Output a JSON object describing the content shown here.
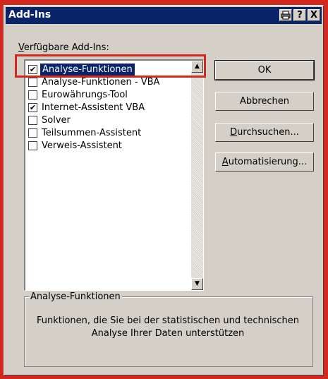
{
  "window": {
    "title": "Add-Ins",
    "buttons": {
      "toolbar_icon": "printer-icon",
      "help": "?",
      "close": "X"
    }
  },
  "available_label_prefix": "V",
  "available_label_rest": "erfügbare Add-Ins:",
  "addins": [
    {
      "label": "Analyse-Funktionen",
      "checked": true,
      "selected": true
    },
    {
      "label": "Analyse-Funktionen - VBA",
      "checked": false,
      "selected": false
    },
    {
      "label": "Eurowährungs-Tool",
      "checked": false,
      "selected": false
    },
    {
      "label": "Internet-Assistent VBA",
      "checked": true,
      "selected": false
    },
    {
      "label": "Solver",
      "checked": false,
      "selected": false
    },
    {
      "label": "Teilsummen-Assistent",
      "checked": false,
      "selected": false
    },
    {
      "label": "Verweis-Assistent",
      "checked": false,
      "selected": false
    }
  ],
  "buttons": {
    "ok": "OK",
    "cancel": "Abbrechen",
    "browse_u": "D",
    "browse_rest": "urchsuchen...",
    "automation_u": "A",
    "automation_rest": "utomatisierung..."
  },
  "description": {
    "title": "Analyse-Funktionen",
    "text": "Funktionen, die Sie bei der statistischen und technischen Analyse Ihrer Daten unterstützen"
  },
  "colors": {
    "title_bar": "#0a246a",
    "highlight_frame": "#d4281f",
    "dialog_bg": "#d4d0c8"
  }
}
